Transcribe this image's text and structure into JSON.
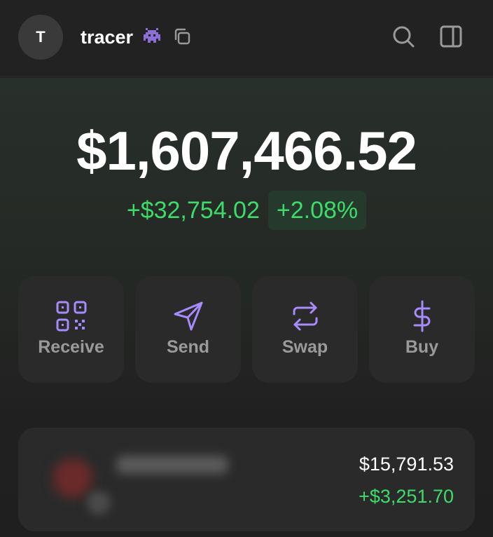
{
  "header": {
    "avatar_initial": "T",
    "account_name": "tracer",
    "alien_icon": "alien-monster-icon",
    "copy_icon": "copy-icon",
    "search_icon": "search-icon",
    "panel_icon": "side-panel-icon"
  },
  "portfolio": {
    "balance": "$1,607,466.52",
    "change_amount": "+$32,754.02",
    "change_percent": "+2.08%"
  },
  "actions": [
    {
      "label": "Receive",
      "icon": "qr-code-icon"
    },
    {
      "label": "Send",
      "icon": "send-icon"
    },
    {
      "label": "Swap",
      "icon": "swap-icon"
    },
    {
      "label": "Buy",
      "icon": "dollar-icon"
    }
  ],
  "token": {
    "value": "$15,791.53",
    "change": "+$3,251.70"
  },
  "colors": {
    "accent": "#a78bfa",
    "positive": "#3ddc6a",
    "card": "#2a2a2a",
    "background": "#1f1f1f"
  }
}
